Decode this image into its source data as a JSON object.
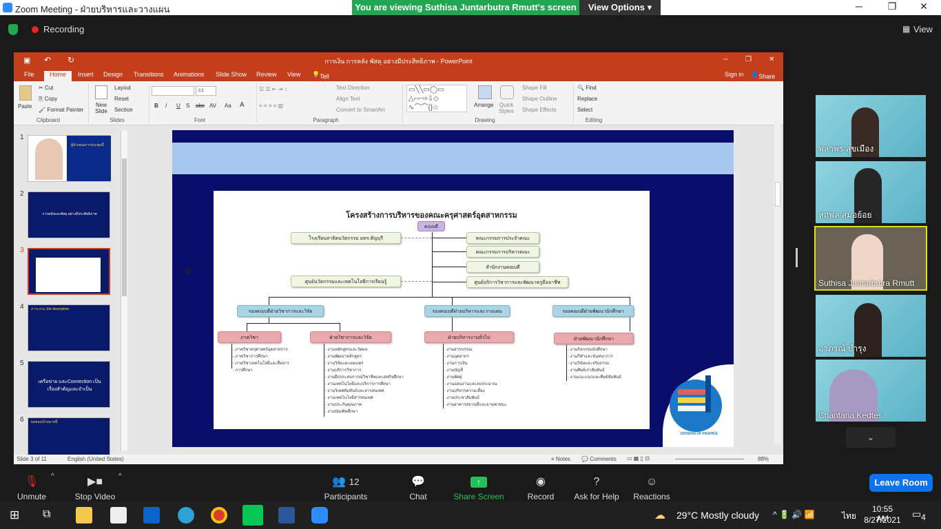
{
  "zoom": {
    "title": "Zoom Meeting - ฝ่ายบริหารและวางแผน",
    "viewing_banner": "You are viewing Suthisa Juntarbutra Rmutt's screen",
    "view_options": "View Options",
    "recording": "Recording",
    "view": "View"
  },
  "ppt": {
    "title": "การเงิน การคลัง พัสดุ อย่างมีประสิทธิภาพ - PowerPoint",
    "tabs": [
      "File",
      "Home",
      "Insert",
      "Design",
      "Transitions",
      "Animations",
      "Slide Show",
      "Review",
      "View"
    ],
    "tell_me": "Tell me what you want to do...",
    "sign_in": "Sign in",
    "share": "Share",
    "ribbon": {
      "clipboard": {
        "paste": "Paste",
        "cut": "Cut",
        "copy": "Copy",
        "format_painter": "Format Painter",
        "label": "Clipboard"
      },
      "slides": {
        "new_slide": "New Slide",
        "layout": "Layout",
        "reset": "Reset",
        "section": "Section",
        "label": "Slides"
      },
      "font": {
        "size": "44",
        "label": "Font",
        "bold": "B",
        "italic": "I",
        "underline": "U",
        "strike": "S",
        "shadow": "abc",
        "spacing": "AV",
        "case": "Aa",
        "color": "A"
      },
      "paragraph": {
        "text_direction": "Text Direction",
        "align_text": "Align Text",
        "convert": "Convert to SmartArt",
        "label": "Paragraph"
      },
      "drawing": {
        "arrange": "Arrange",
        "quick_styles": "Quick Styles",
        "shape_fill": "Shape Fill",
        "shape_outline": "Shape Outline",
        "shape_effects": "Shape Effects",
        "label": "Drawing"
      },
      "editing": {
        "find": "Find",
        "replace": "Replace",
        "select": "Select",
        "label": "Editing"
      }
    },
    "thumbs": [
      {
        "num": "1",
        "text": "ผู้นำเสนอการประชุมนี้"
      },
      {
        "num": "2",
        "text": "การคลังและพัสดุ อย่างมีประสิทธิภาพ"
      },
      {
        "num": "3",
        "text": ""
      },
      {
        "num": "4",
        "text": "ภาระงาน Job description"
      },
      {
        "num": "5",
        "text": "เครือข่าย และConnection เป็นเรื่องสำคัญและจำเป็น"
      },
      {
        "num": "6",
        "text": "ผลของเป้าหมายนี้"
      }
    ],
    "status": {
      "slide": "Slide 3 of 11",
      "lang": "English (United States)",
      "notes": "Notes",
      "comments": "Comments",
      "zoom": "88%"
    }
  },
  "org": {
    "title": "โครงสร้างการบริหารของคณะครุศาสตร์อุตสาหกรรม",
    "dean": "คณบดี",
    "left_top": "โรงเรียนสาธิตนวัตกรรม มทร.ธัญบุรี",
    "left_mid": "ศูนย์นวัตกรรมและเทคโนโลยีการเรียนรู้",
    "right": [
      "คณะกรรมการประจำคณะ",
      "คณะกรรมการบริหารคณะ",
      "สำนักงานคณบดี",
      "ศูนย์บริการวิชาการและพัฒนาครูมืออาชีพ"
    ],
    "vps": [
      "รองคณบดีฝ่ายวิชาการและวิจัย",
      "รองคณบดีฝ่ายบริหารและวางแผน",
      "รองคณบดีฝ่ายพัฒนานักศึกษา"
    ],
    "subs": [
      "ภาควิชา",
      "ฝ่ายวิชาการและวิจัย",
      "ฝ่ายบริหารงานทั่วไป",
      "ฝ่ายพัฒนานักศึกษา"
    ],
    "list_dept": [
      "ภาควิชาครุศาสตร์อุตสาหการ",
      "ภาควิชาการศึกษา",
      "ภาควิชาเทคโนโลยีและสื่อสาร",
      "การศึกษา"
    ],
    "list_acad": [
      "งานหลักสูตรและวัดผล",
      "งานพัฒนาหลักสูตร",
      "งานวิจัยและเผยแพร่",
      "งานบริการวิชาการ",
      "งานฝึกประสบการณ์วิชาชีพและสหกิจศึกษา",
      "งานเทคโนโลยีและบริการการศึกษา",
      "งานวิเทศสัมพันธ์และสารสนเทศ",
      "งานเทคโนโลยีสารสนเทศ",
      "งานประกันคุณภาพ",
      "งานบัณฑิตศึกษา"
    ],
    "list_admin": [
      "งานสารบรรณ",
      "งานบุคลากร",
      "งานการเงิน",
      "งานบัญชี",
      "งานพัสดุ",
      "งานแผนงานและงบประมาณ",
      "งานบริหารความเสี่ยง",
      "งานประชาสัมพันธ์",
      "งานอาคารสถานที่และยานพาหนะ"
    ],
    "list_student": [
      "งานกิจกรรมนักศึกษา",
      "งานกีฬาและนันทนาการ",
      "งานวินัยและจริยธรรม",
      "งานศิษย์เก่าสัมพันธ์",
      "งานแนะแนวและศิษย์สัมพันธ์"
    ],
    "logo_text": "DIVISION OF FINANCE"
  },
  "participants": [
    {
      "name": "พลาพร สุขเมือง"
    },
    {
      "name": "หฤพล สมอย้อย"
    },
    {
      "name": "Suthisa  Juntarbutra Rmutt"
    },
    {
      "name": "อาภรณ์ บำรุง"
    },
    {
      "name": "Chantana Kedtes"
    }
  ],
  "toolbar": {
    "unmute": "Unmute",
    "stop_video": "Stop Video",
    "participants": "Participants",
    "participants_count": "12",
    "chat": "Chat",
    "share_screen": "Share Screen",
    "record": "Record",
    "help": "Ask for Help",
    "reactions": "Reactions",
    "leave": "Leave Room"
  },
  "taskbar": {
    "weather": "29°C  Mostly cloudy",
    "lang": "ไทย",
    "time": "10:55 AM",
    "date": "8/27/2021",
    "notif": "4"
  }
}
